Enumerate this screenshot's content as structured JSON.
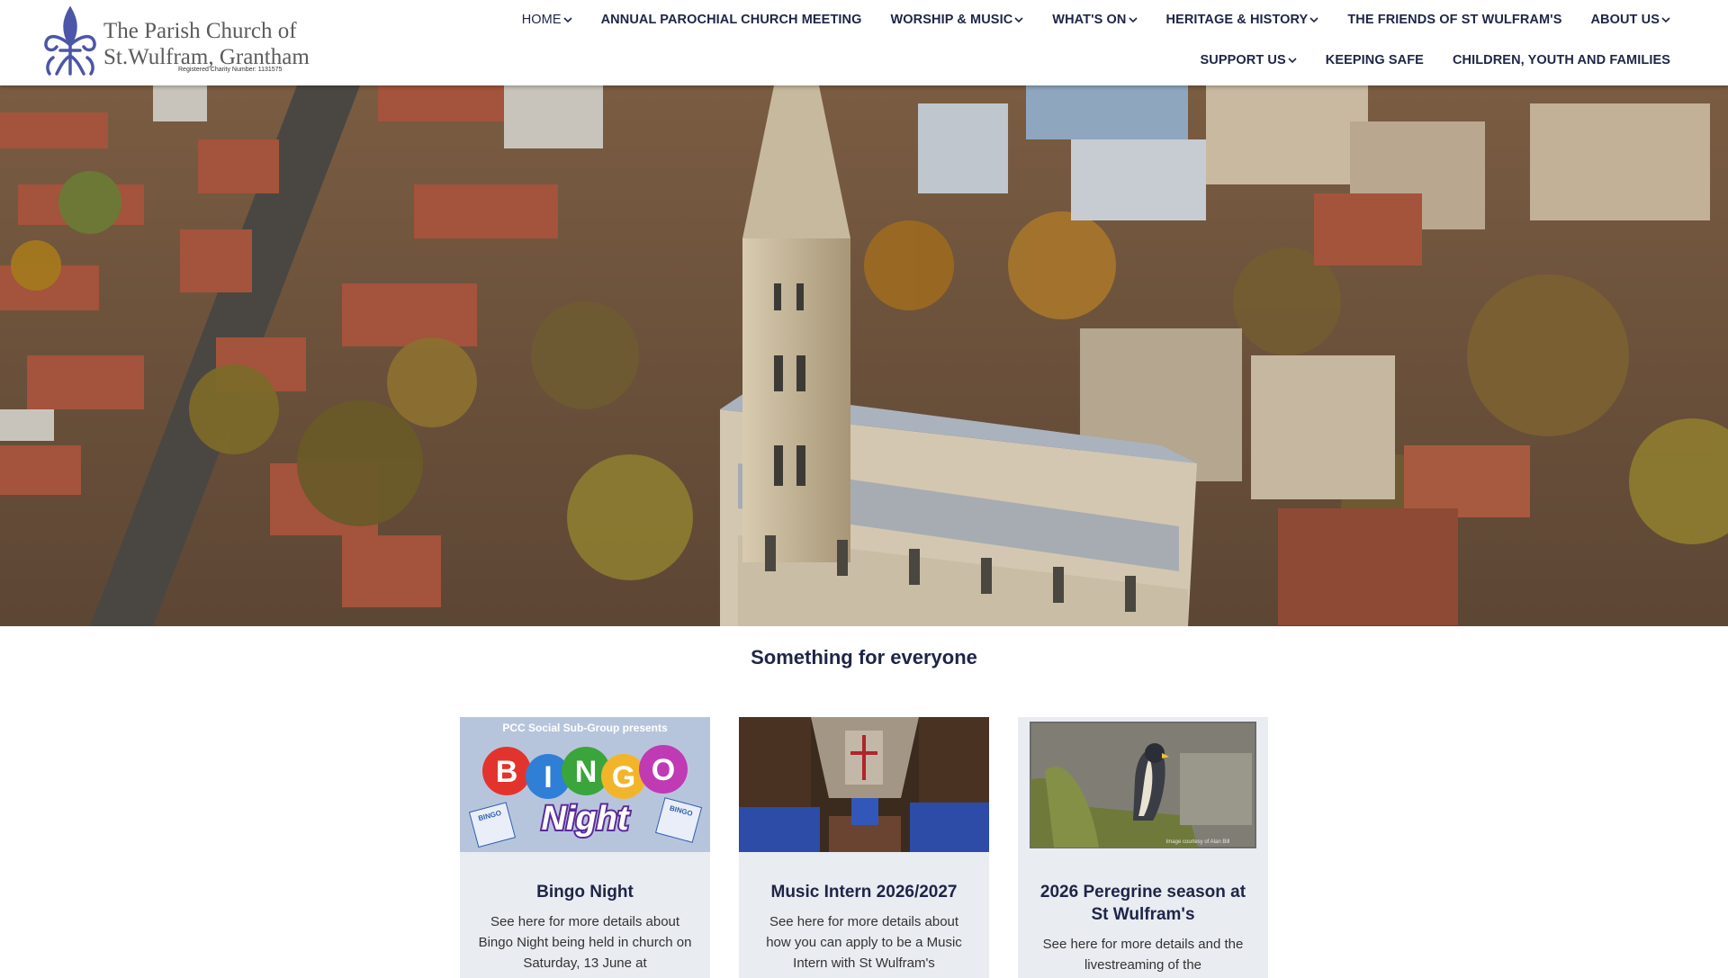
{
  "brand": {
    "title_line1": "The Parish Church of",
    "title_line2": "St.Wulfram, Grantham",
    "charity": "Registered Charity Number: 1131575"
  },
  "nav": {
    "row1": [
      {
        "label": "HOME",
        "dropdown": true
      },
      {
        "label": "ANNUAL PAROCHIAL CHURCH MEETING",
        "dropdown": false
      },
      {
        "label": "WORSHIP & MUSIC",
        "dropdown": true
      },
      {
        "label": "WHAT'S ON",
        "dropdown": true
      },
      {
        "label": "HERITAGE & HISTORY",
        "dropdown": true
      },
      {
        "label": "THE FRIENDS OF ST WULFRAM'S",
        "dropdown": false
      },
      {
        "label": "ABOUT US",
        "dropdown": true
      }
    ],
    "row2": [
      {
        "label": "SUPPORT US",
        "dropdown": true
      },
      {
        "label": "KEEPING SAFE",
        "dropdown": false
      },
      {
        "label": "CHILDREN, YOUTH AND FAMILIES",
        "dropdown": false
      }
    ]
  },
  "section": {
    "title": "Something for everyone"
  },
  "cards": [
    {
      "title": "Bingo Night",
      "text": "See here for more details about Bingo Night being held in church on Saturday, 13 June at",
      "image_text": {
        "top": "PCC Social Sub-Group presents",
        "letters": [
          "B",
          "I",
          "N",
          "G",
          "O"
        ],
        "bottom": "Night",
        "card_label": "BINGO"
      }
    },
    {
      "title": "Music Intern 2026/2027",
      "text": "See here for more details about how you can apply to be a Music Intern with St Wulfram's"
    },
    {
      "title": "2026 Peregrine season at St Wulfram's",
      "text": "See here for more details and the livestreaming of the",
      "image_credit": "Image courtesy of Alan Bill"
    }
  ],
  "colors": {
    "brand_navy": "#1e2547",
    "logo_blue": "#4b56a8",
    "card_bg": "#e9ecf1"
  },
  "icons": [
    "chevron-down-icon",
    "fleur-de-lis-logo"
  ]
}
